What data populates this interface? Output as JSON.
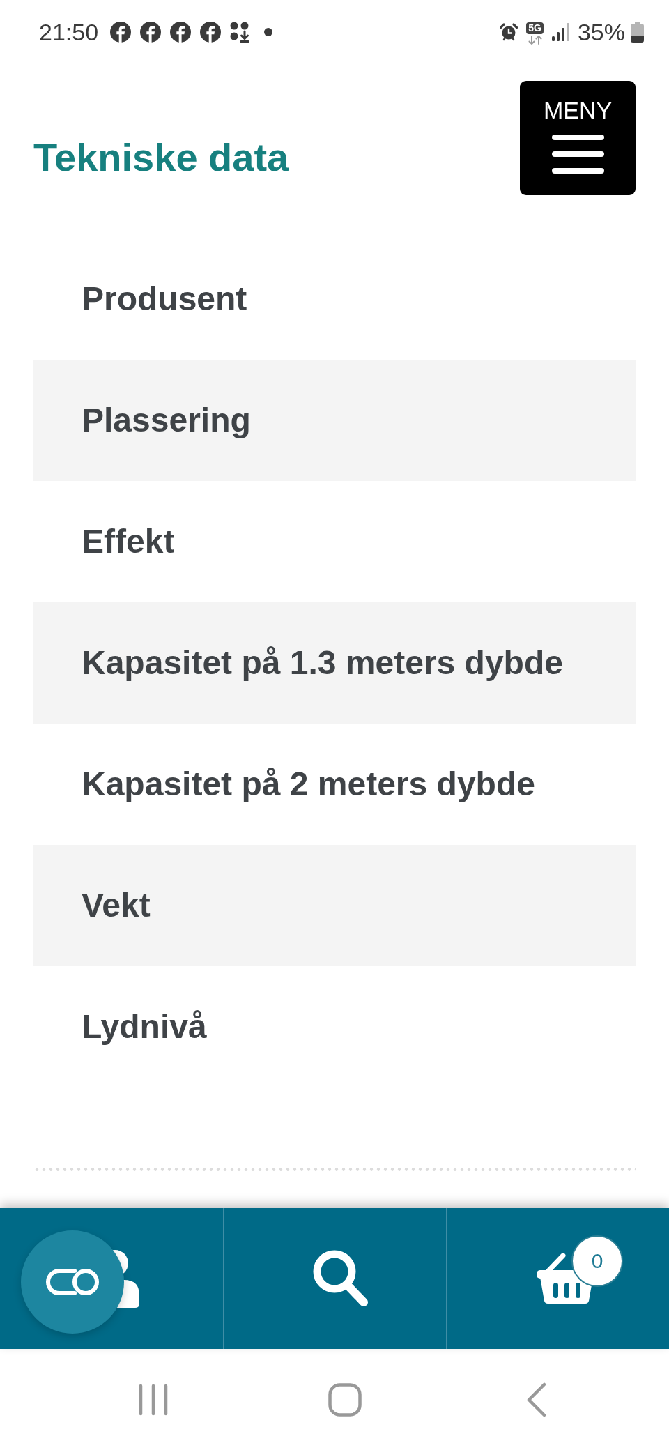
{
  "status_bar": {
    "time": "21:50",
    "network_type": "5G",
    "battery": "35%"
  },
  "menu_button": {
    "label": "MENY"
  },
  "tech_data": {
    "title": "Tekniske data",
    "rows": [
      "Produsent",
      "Plassering",
      "Effekt",
      "Kapasitet på 1.3 meters dybde",
      "Kapasitet på 2 meters dybde",
      "Vekt",
      "Lydnivå"
    ]
  },
  "bottom_nav": {
    "cart_count": "0"
  }
}
